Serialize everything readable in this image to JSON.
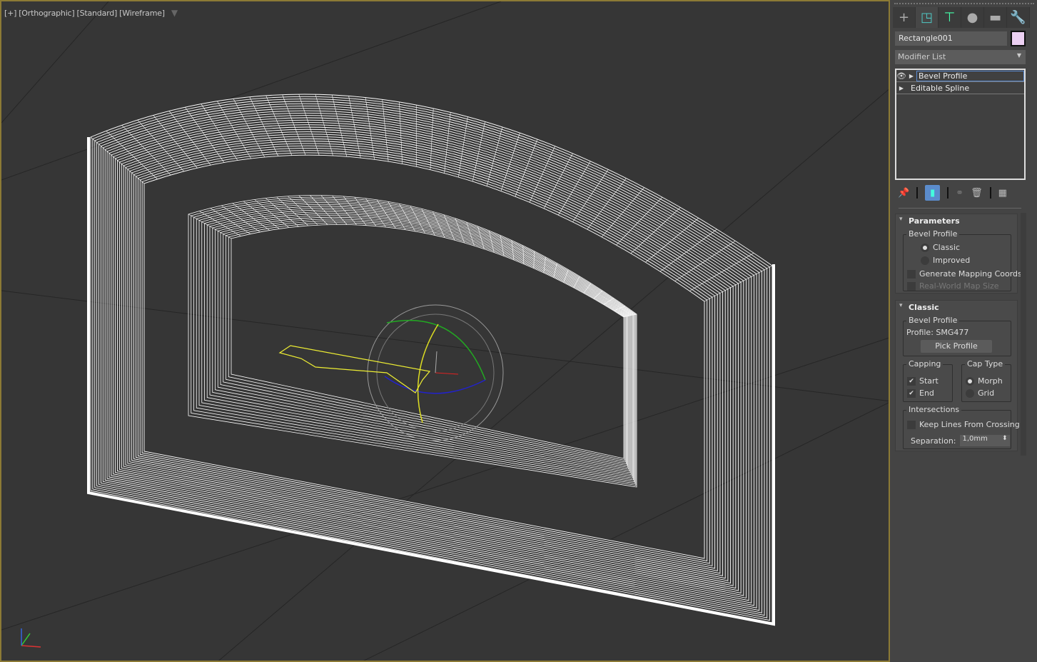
{
  "viewport": {
    "labels": [
      "[+]",
      "[Orthographic]",
      "[Standard]",
      "[Wireframe]"
    ],
    "filter_icon": "funnel-icon"
  },
  "command_panel": {
    "tabs": [
      {
        "name": "create",
        "icon": "plus-icon"
      },
      {
        "name": "modify",
        "icon": "modify-icon"
      },
      {
        "name": "hierarchy",
        "icon": "hierarchy-icon"
      },
      {
        "name": "motion",
        "icon": "motion-icon"
      },
      {
        "name": "display",
        "icon": "display-icon"
      },
      {
        "name": "utilities",
        "icon": "wrench-icon"
      }
    ],
    "object_name": "Rectangle001",
    "object_color": "#ecd0f2",
    "modifier_list": "Modifier List",
    "stack": [
      "Bevel Profile",
      "Editable Spline"
    ]
  },
  "parameters": {
    "title": "Parameters",
    "group": "Bevel Profile",
    "options": [
      "Classic",
      "Improved"
    ],
    "selected": "Classic",
    "gen_mapping": "Generate Mapping Coords.",
    "real_world": "Real-World Map Size"
  },
  "classic": {
    "title": "Classic",
    "group": "Bevel Profile",
    "profile": "Profile: SMG477",
    "pick": "Pick Profile",
    "capping": "Capping",
    "start": "Start",
    "end": "End",
    "cap_type": "Cap Type",
    "morph": "Morph",
    "grid": "Grid",
    "intersections": "Intersections",
    "keep_lines": "Keep Lines From Crossing",
    "separation_label": "Separation:",
    "separation": "1,0mm"
  }
}
